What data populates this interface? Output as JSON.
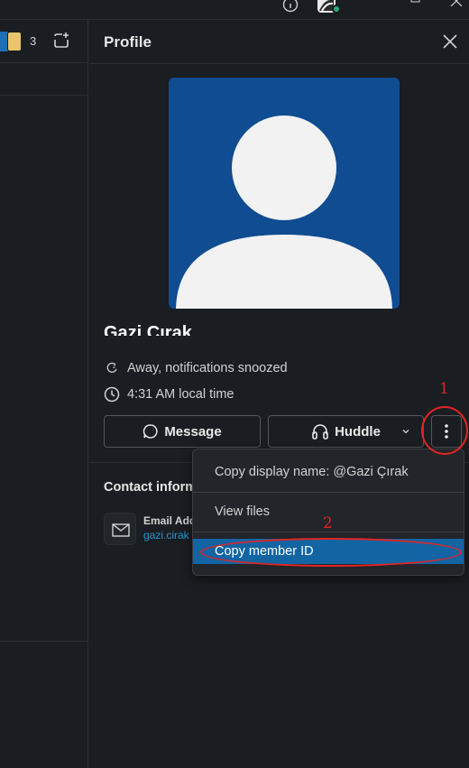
{
  "colors": {
    "background": "#1a1d21",
    "border": "#2c2f33",
    "photo_bg": "#0f4c92",
    "highlight": "#1264a3",
    "link": "#1d9bd1",
    "presence": "#2bac76",
    "annotation": "#e02424"
  },
  "channel": {
    "member_count": "3"
  },
  "profile": {
    "title": "Profile",
    "name": "Gazi Çırak",
    "status": "Away, notifications snoozed",
    "local_time": "4:31 AM local time",
    "buttons": {
      "message": "Message",
      "huddle": "Huddle"
    },
    "contact": {
      "title": "Contact information",
      "email_label": "Email Address",
      "email_value": "gazi.cirak"
    }
  },
  "menu": {
    "items": [
      {
        "label": "Copy display name: @Gazi Çırak"
      },
      {
        "label": "View files"
      },
      {
        "label": "Copy member ID",
        "highlighted": true
      }
    ]
  },
  "annotations": {
    "step1": "1",
    "step2": "2"
  },
  "icons": [
    "help-icon",
    "user-avatar",
    "restore-icon",
    "close-icon",
    "canvas-icon",
    "person-icon",
    "snooze-icon",
    "clock-icon",
    "message-icon",
    "headphones-icon",
    "chevron-down-icon",
    "more-vertical-icon",
    "mail-icon"
  ]
}
